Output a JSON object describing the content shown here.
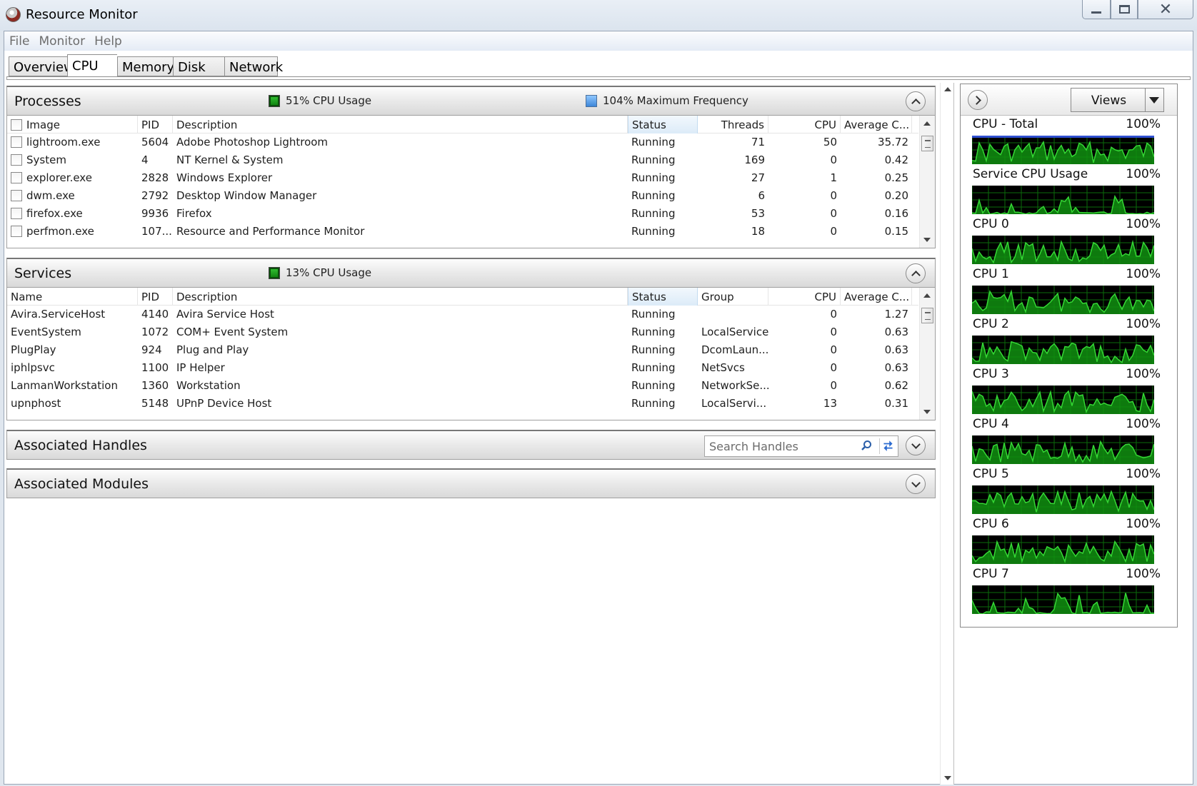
{
  "window": {
    "title": "Resource Monitor"
  },
  "menu": [
    "File",
    "Monitor",
    "Help"
  ],
  "tabs": [
    {
      "label": "Overview",
      "active": false
    },
    {
      "label": "CPU",
      "active": true
    },
    {
      "label": "Memory",
      "active": false
    },
    {
      "label": "Disk",
      "active": false
    },
    {
      "label": "Network",
      "active": false
    }
  ],
  "processes": {
    "title": "Processes",
    "usage_label": "51% CPU Usage",
    "freq_label": "104% Maximum Frequency",
    "columns": [
      "Image",
      "PID",
      "Description",
      "Status",
      "Threads",
      "CPU",
      "Average C..."
    ],
    "rows": [
      [
        "lightroom.exe",
        "5604",
        "Adobe Photoshop Lightroom",
        "Running",
        "71",
        "50",
        "35.72"
      ],
      [
        "System",
        "4",
        "NT Kernel & System",
        "Running",
        "169",
        "0",
        "0.42"
      ],
      [
        "explorer.exe",
        "2828",
        "Windows Explorer",
        "Running",
        "27",
        "1",
        "0.25"
      ],
      [
        "dwm.exe",
        "2792",
        "Desktop Window Manager",
        "Running",
        "6",
        "0",
        "0.20"
      ],
      [
        "firefox.exe",
        "9936",
        "Firefox",
        "Running",
        "53",
        "0",
        "0.16"
      ],
      [
        "perfmon.exe",
        "107...",
        "Resource and Performance Monitor",
        "Running",
        "18",
        "0",
        "0.15"
      ]
    ]
  },
  "services": {
    "title": "Services",
    "usage_label": "13% CPU Usage",
    "columns": [
      "Name",
      "PID",
      "Description",
      "Status",
      "Group",
      "CPU",
      "Average C..."
    ],
    "rows": [
      [
        "Avira.ServiceHost",
        "4140",
        "Avira Service Host",
        "Running",
        "",
        "0",
        "1.27"
      ],
      [
        "EventSystem",
        "1072",
        "COM+ Event System",
        "Running",
        "LocalService",
        "0",
        "0.63"
      ],
      [
        "PlugPlay",
        "924",
        "Plug and Play",
        "Running",
        "DcomLaun...",
        "0",
        "0.63"
      ],
      [
        "iphlpsvc",
        "1100",
        "IP Helper",
        "Running",
        "NetSvcs",
        "0",
        "0.63"
      ],
      [
        "LanmanWorkstation",
        "1360",
        "Workstation",
        "Running",
        "NetworkSe...",
        "0",
        "0.62"
      ],
      [
        "upnphost",
        "5148",
        "UPnP Device Host",
        "Running",
        "LocalServi...",
        "13",
        "0.31"
      ]
    ]
  },
  "handles": {
    "title": "Associated Handles",
    "search_placeholder": "Search Handles"
  },
  "modules": {
    "title": "Associated Modules"
  },
  "graph_pane": {
    "views_label": "Views",
    "graphs": [
      {
        "title": "CPU - Total",
        "max": "100%",
        "blue_top": true
      },
      {
        "title": "Service CPU Usage",
        "max": "100%"
      },
      {
        "title": "CPU 0",
        "max": "100%"
      },
      {
        "title": "CPU 1",
        "max": "100%"
      },
      {
        "title": "CPU 2",
        "max": "100%"
      },
      {
        "title": "CPU 3",
        "max": "100%"
      },
      {
        "title": "CPU 4",
        "max": "100%"
      },
      {
        "title": "CPU 5",
        "max": "100%"
      },
      {
        "title": "CPU 6",
        "max": "100%"
      },
      {
        "title": "CPU 7",
        "max": "100%"
      }
    ]
  },
  "colors": {
    "graph_bg": "#000000",
    "graph_grid": "#0b6b0b",
    "graph_line": "#35d835",
    "graph_fill": "#118f11",
    "freq_line": "#2f4fd0"
  }
}
